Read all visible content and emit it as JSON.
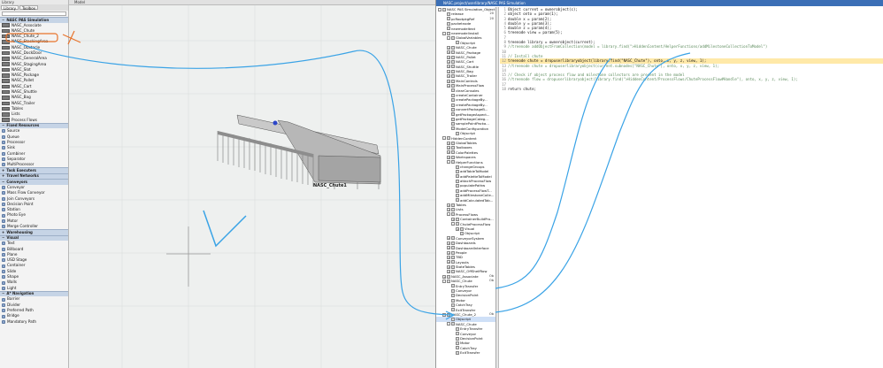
{
  "library": {
    "title": "Library",
    "tabs": [
      {
        "label": "Library"
      },
      {
        "label": "Toolbox"
      }
    ],
    "nasc_category": "NASC PAS Simulation",
    "nasc_items": [
      {
        "label": "NASC_Associate"
      },
      {
        "label": "NASC_Chute"
      },
      {
        "label": "NASC_Chute_2"
      },
      {
        "label": "NASC_StackingArea"
      },
      {
        "label": "NASC_Obstacle"
      },
      {
        "label": "NASC_DockDoor"
      },
      {
        "label": "NASC_GeneralArea"
      },
      {
        "label": "NASC_StagingArea"
      },
      {
        "label": "NASC_Slot"
      },
      {
        "label": "NASC_Package"
      },
      {
        "label": "NASC_Pallet"
      },
      {
        "label": "NASC_Cart"
      },
      {
        "label": "NASC_Shuttle"
      },
      {
        "label": "NASC_Bag"
      },
      {
        "label": "NASC_Trailer"
      },
      {
        "label": "Tables"
      },
      {
        "label": "Lists"
      },
      {
        "label": "Process Flows"
      }
    ],
    "fixed_category": "Fixed Resources",
    "fixed_items": [
      {
        "label": "Source"
      },
      {
        "label": "Queue"
      },
      {
        "label": "Processor"
      },
      {
        "label": "Sink"
      },
      {
        "label": "Combiner"
      },
      {
        "label": "Separator"
      },
      {
        "label": "MultiProcessor"
      }
    ],
    "task_category": "Task Executers",
    "travel_category": "Travel Networks",
    "conveyors_category": "Conveyors",
    "conveyor_items": [
      {
        "label": "Conveyor"
      },
      {
        "label": "Mass Flow Conveyor"
      },
      {
        "label": "Join Conveyors"
      },
      {
        "label": "Decision Point"
      },
      {
        "label": "Station"
      },
      {
        "label": "Photo Eye"
      },
      {
        "label": "Motor"
      },
      {
        "label": "Merge Controller"
      }
    ],
    "warehousing_category": "Warehousing",
    "visual_category": "Visual",
    "visual_items": [
      {
        "label": "Text"
      },
      {
        "label": "Billboard"
      },
      {
        "label": "Plane"
      },
      {
        "label": "USD Stage"
      },
      {
        "label": "Container"
      },
      {
        "label": "Slide"
      },
      {
        "label": "Shape"
      },
      {
        "label": "Walls"
      },
      {
        "label": "Light"
      }
    ],
    "astar_category": "A* Navigation",
    "astar_items": [
      {
        "label": "Barrier"
      },
      {
        "label": "Divider"
      },
      {
        "label": "Preferred Path"
      },
      {
        "label": "Bridge"
      },
      {
        "label": "Mandatory Path"
      }
    ]
  },
  "model": {
    "title": "Model",
    "object_label": "NASC_Chute1"
  },
  "tree_window": {
    "title": "NASC.project/userlibrary/NASC PAS Simulation"
  },
  "tree": [
    {
      "label": "NASC PAS Simulation_Object",
      "d": 0,
      "ex": "-"
    },
    {
      "label": "release",
      "d": 1,
      "ex": "",
      "v": "20"
    },
    {
      "label": "pcRootpkgRef",
      "d": 1,
      "ex": "",
      "v": "20"
    },
    {
      "label": "packetnode",
      "d": 1,
      "ex": ""
    },
    {
      "label": "newmodeltext",
      "d": 1,
      "ex": ""
    },
    {
      "label": "newmodelinstall",
      "d": 1,
      "ex": "-"
    },
    {
      "label": "GlobalVariables",
      "d": 2,
      "ex": "-"
    },
    {
      "label": "Objscript",
      "d": 3,
      "ex": ""
    },
    {
      "label": "NASC_Chute",
      "d": 2,
      "ex": "+"
    },
    {
      "label": "NASC_Package",
      "d": 2,
      "ex": "+"
    },
    {
      "label": "NASC_Pallet",
      "d": 2,
      "ex": "+"
    },
    {
      "label": "NASC_Cart",
      "d": 2,
      "ex": "+"
    },
    {
      "label": "NASC_Shuttle",
      "d": 2,
      "ex": "+"
    },
    {
      "label": "NASC_Bag",
      "d": 2,
      "ex": "+"
    },
    {
      "label": "NASC_Trailer",
      "d": 2,
      "ex": "+"
    },
    {
      "label": "MainControls",
      "d": 2,
      "ex": "+"
    },
    {
      "label": "MainProcessFlow",
      "d": 2,
      "ex": "+"
    },
    {
      "label": "clearConsoles",
      "d": 2,
      "ex": ""
    },
    {
      "label": "createContainer",
      "d": 2,
      "ex": ""
    },
    {
      "label": "createPackageBy...",
      "d": 2,
      "ex": ""
    },
    {
      "label": "createPackageBy...",
      "d": 2,
      "ex": ""
    },
    {
      "label": "convertPackageB...",
      "d": 2,
      "ex": ""
    },
    {
      "label": "getPackageAspect...",
      "d": 2,
      "ex": ""
    },
    {
      "label": "getPackageCateg...",
      "d": 2,
      "ex": ""
    },
    {
      "label": "samplePointPacka...",
      "d": 2,
      "ex": ""
    },
    {
      "label": "ModelConfiguration",
      "d": 2,
      "ex": ""
    },
    {
      "label": "Objscript",
      "d": 3,
      "ex": ""
    },
    {
      "label": "HiddenContent",
      "d": 1,
      "ex": "-"
    },
    {
      "label": "GlobalTables",
      "d": 2,
      "ex": "+"
    },
    {
      "label": "Toolboxes",
      "d": 2,
      "ex": "+"
    },
    {
      "label": "ColorPalettes",
      "d": 2,
      "ex": "+"
    },
    {
      "label": "Workspaces",
      "d": 2,
      "ex": "+"
    },
    {
      "label": "HelperFunctions",
      "d": 2,
      "ex": "-"
    },
    {
      "label": "changeGroups",
      "d": 3,
      "ex": ""
    },
    {
      "label": "addTableToModel",
      "d": 3,
      "ex": ""
    },
    {
      "label": "addPaletteToModel",
      "d": 3,
      "ex": ""
    },
    {
      "label": "attachProcessFlow",
      "d": 3,
      "ex": ""
    },
    {
      "label": "populatePathw",
      "d": 3,
      "ex": ""
    },
    {
      "label": "addProcessFlowT...",
      "d": 3,
      "ex": ""
    },
    {
      "label": "addMilestoneColle...",
      "d": 3,
      "ex": ""
    },
    {
      "label": "addCalculatedTab...",
      "d": 3,
      "ex": ""
    },
    {
      "label": "Tables",
      "d": 2,
      "ex": "+"
    },
    {
      "label": "Lists",
      "d": 2,
      "ex": "+"
    },
    {
      "label": "ProcessFlows",
      "d": 2,
      "ex": "-"
    },
    {
      "label": "ContainerBuildPro...",
      "d": 3,
      "ex": "+"
    },
    {
      "label": "ChuteProcessFlow",
      "d": 3,
      "ex": "-"
    },
    {
      "label": "Visual",
      "d": 4,
      "ex": "+"
    },
    {
      "label": "Objscript",
      "d": 4,
      "ex": ""
    },
    {
      "label": "ConveyorSystem",
      "d": 2,
      "ex": "+"
    },
    {
      "label": "Dashboards",
      "d": 2,
      "ex": "+"
    },
    {
      "label": "DashboardInterface",
      "d": 2,
      "ex": "+"
    },
    {
      "label": "People",
      "d": 2,
      "ex": "+"
    },
    {
      "label": "TBD",
      "d": 2,
      "ex": "+"
    },
    {
      "label": "Layouts",
      "d": 2,
      "ex": "+"
    },
    {
      "label": "StateTables",
      "d": 2,
      "ex": "+"
    },
    {
      "label": "NASC_OffShelfRow",
      "d": 2,
      "ex": "+"
    },
    {
      "label": "NASC_Associate",
      "d": 1,
      "ex": "+",
      "v": "Ob"
    },
    {
      "label": "NASC_Chute",
      "d": 1,
      "ex": "-",
      "v": "Ob"
    },
    {
      "label": "EntryTransfer",
      "d": 2,
      "ex": ""
    },
    {
      "label": "Conveyor",
      "d": 2,
      "ex": ""
    },
    {
      "label": "DecisionPoint",
      "d": 2,
      "ex": ""
    },
    {
      "label": "Motor",
      "d": 2,
      "ex": ""
    },
    {
      "label": "CatchTray",
      "d": 2,
      "ex": ""
    },
    {
      "label": "ExitTransfer",
      "d": 2,
      "ex": ""
    },
    {
      "label": "NASC_Chute_2",
      "d": 1,
      "ex": "-",
      "v": "Ob"
    },
    {
      "label": "Objscript",
      "d": 2,
      "ex": "",
      "sel": true
    },
    {
      "label": "NASC_Chute",
      "d": 2,
      "ex": "-"
    },
    {
      "label": "EntryTransfer",
      "d": 3,
      "ex": ""
    },
    {
      "label": "Conveyor",
      "d": 3,
      "ex": ""
    },
    {
      "label": "DecisionPoint",
      "d": 3,
      "ex": ""
    },
    {
      "label": "Motor",
      "d": 3,
      "ex": ""
    },
    {
      "label": "CatchTray",
      "d": 3,
      "ex": ""
    },
    {
      "label": "ExitTransfer",
      "d": 3,
      "ex": ""
    }
  ],
  "code_lines": [
    {
      "n": "1",
      "t": "Object current = ownerobject(c);"
    },
    {
      "n": "2",
      "t": "object onto = param(1);"
    },
    {
      "n": "3",
      "t": "double x = param(2);"
    },
    {
      "n": "4",
      "t": "double y = param(3);"
    },
    {
      "n": "5",
      "t": "double z = param(4);"
    },
    {
      "n": "6",
      "t": "treenode view = param(5);"
    },
    {
      "n": "7",
      "t": ""
    },
    {
      "n": "8",
      "t": "treenode library = ownerobject(current);"
    },
    {
      "n": "9",
      "t": "//treenode addObjectFromCollection(model = library.find(\">HiddenContent/HelperFunctions/addMilestoneCollectionToModel\")",
      "c": true
    },
    {
      "n": "10",
      "t": ""
    },
    {
      "n": "11",
      "t": "// Install chute",
      "c": true
    },
    {
      "n": "12",
      "t": "treenode chute = dropuserlibraryobject(library.find(\"NASC_Chute\"), onto, x, y, z, view, 1);",
      "h": true
    },
    {
      "n": "13",
      "t": "//treenode chute = dropuserlibraryobject(current.subnodes[\"NASC_Chute\"], onto, x, y, z, view, 1);",
      "c": true
    },
    {
      "n": "14",
      "t": ""
    },
    {
      "n": "15",
      "t": "// Check if object process flow and milestone collectors are present in the model",
      "c": true
    },
    {
      "n": "16",
      "t": "//treenode flow = dropuserlibraryobject(library.find(\">HiddenContent/ProcessFlows/ChuteProcessFlow#Handle\"), onto, x, y, z, view, 1);",
      "c": true
    },
    {
      "n": "17",
      "t": ""
    },
    {
      "n": "18",
      "t": "return chute;"
    }
  ]
}
